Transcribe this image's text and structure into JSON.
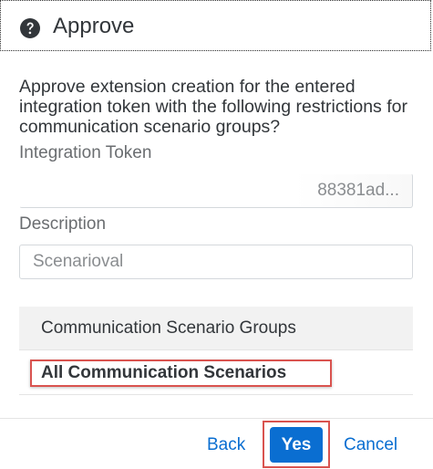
{
  "dialog": {
    "title": "Approve",
    "icon": "question-circle-icon",
    "message": "Approve extension creation for the entered integration token with the following restrictions for communication scenario groups?"
  },
  "form": {
    "token_label": "Integration Token",
    "token_value": "88381ad...",
    "description_label": "Description",
    "description_placeholder": "Scenarioval"
  },
  "groups_table": {
    "header": "Communication Scenario Groups",
    "rows": [
      "All Communication Scenarios"
    ]
  },
  "footer": {
    "back_label": "Back",
    "yes_label": "Yes",
    "cancel_label": "Cancel"
  },
  "colors": {
    "accent": "#0a6ed1",
    "highlight": "#d9534f",
    "text": "#32363a",
    "label": "#6a6d70"
  }
}
